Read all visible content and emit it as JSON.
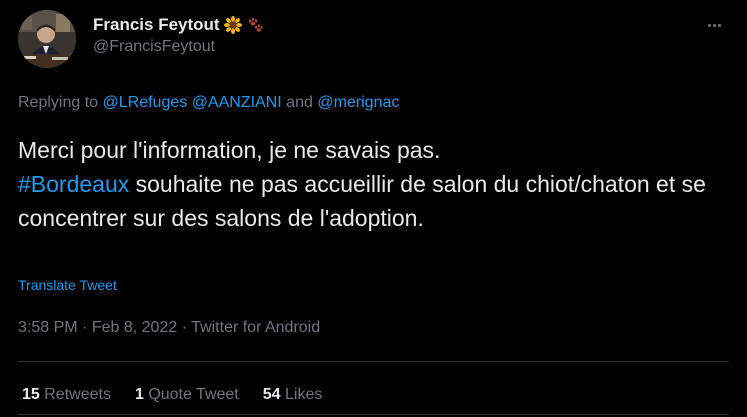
{
  "author": {
    "display_name": "Francis Feytout",
    "handle": "@FrancisFeytout",
    "emojis": [
      "sunflower-icon",
      "paw-prints-icon"
    ]
  },
  "reply": {
    "prefix": "Replying to",
    "mention1": "@LRefuges",
    "mention2": "@AANZIANI",
    "conjunction": "and",
    "mention3": "@merignac"
  },
  "tweet": {
    "text_start": "Merci pour l'information, je ne savais pas.",
    "hashtag": "#Bordeaux",
    "text_end": "souhaite ne pas accueillir de salon du chiot/chaton et se concentrer sur des salons de l'adoption.",
    "translate_label": "Translate Tweet"
  },
  "meta": {
    "time": "3:58 PM",
    "separator": "·",
    "date": "Feb 8, 2022",
    "source": "Twitter for Android"
  },
  "stats": {
    "retweets_count": "15",
    "retweets_label": "Retweets",
    "quotes_count": "1",
    "quotes_label": "Quote Tweet",
    "likes_count": "54",
    "likes_label": "Likes"
  },
  "colors": {
    "background": "#000000",
    "text": "#e7e9ea",
    "secondary": "#71767b",
    "link": "#1d9bf0"
  }
}
